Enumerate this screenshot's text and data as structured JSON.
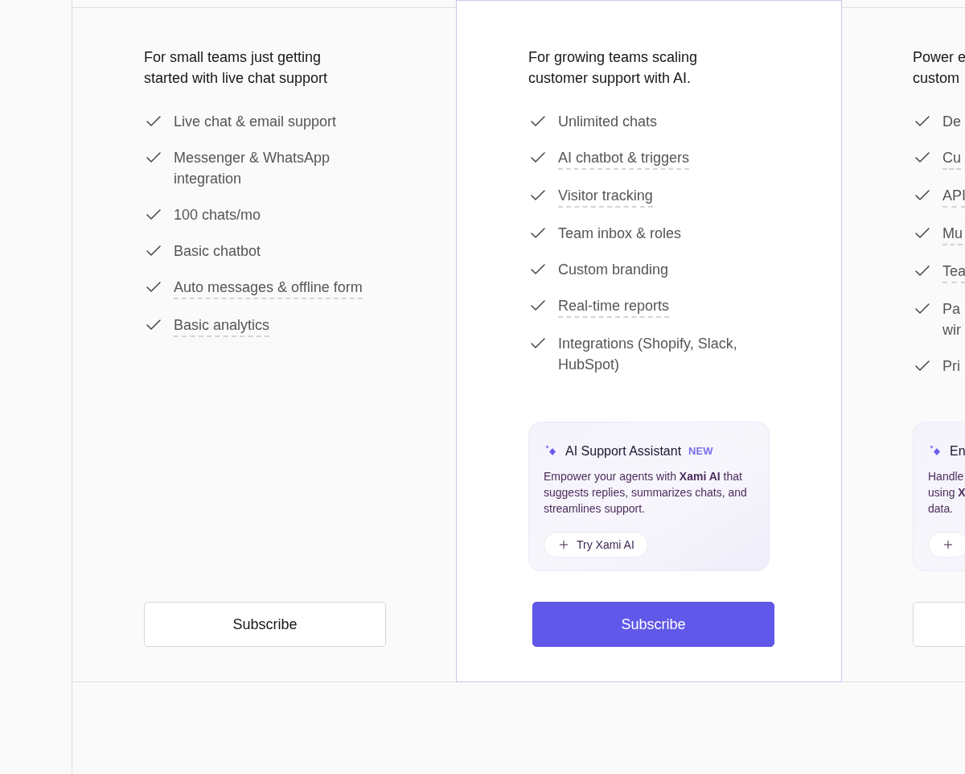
{
  "plans": [
    {
      "highlighted": false,
      "description": "For small teams just getting\nstarted with live chat support",
      "features": [
        {
          "label": "Live chat & email support",
          "underlined": false
        },
        {
          "label": "Messenger & WhatsApp\nintegration",
          "underlined": false
        },
        {
          "label": "100 chats/mo",
          "underlined": false
        },
        {
          "label": "Basic chatbot",
          "underlined": false
        },
        {
          "label": "Auto messages & offline form",
          "underlined": true
        },
        {
          "label": "Basic analytics",
          "underlined": true
        }
      ],
      "subscribe_button": "Subscribe"
    },
    {
      "highlighted": true,
      "description": "For growing teams scaling\ncustomer support with AI.",
      "features": [
        {
          "label": "Unlimited chats",
          "underlined": false
        },
        {
          "label": "AI chatbot & triggers",
          "underlined": true
        },
        {
          "label": "Visitor tracking",
          "underlined": true
        },
        {
          "label": "Team inbox & roles",
          "underlined": false
        },
        {
          "label": "Custom branding",
          "underlined": false
        },
        {
          "label": "Real-time reports",
          "underlined": true
        },
        {
          "label": "Integrations (Shopify, Slack,\nHubSpot)",
          "underlined": false
        }
      ],
      "ai_card": {
        "title": "AI Support Assistant",
        "badge": "NEW",
        "description": "Empower your agents with **Xami AI** that\nsuggests replies, summarizes chats, and\nstreamlines support.",
        "button": "Try Xami AI"
      },
      "subscribe_button": "Subscribe"
    },
    {
      "highlighted": false,
      "description": "Power e\ncustom",
      "features": [
        {
          "label": "De",
          "underlined": false
        },
        {
          "label": "Cu",
          "underlined": true
        },
        {
          "label": "API",
          "underlined": true
        },
        {
          "label": "Mu",
          "underlined": true
        },
        {
          "label": "Tea",
          "underlined": true
        },
        {
          "label": "Pa\nwir",
          "underlined": false
        },
        {
          "label": "Pri",
          "underlined": false
        }
      ],
      "ai_card": {
        "title": "En",
        "description": "Handle\nusing **X**\ndata."
      }
    }
  ]
}
